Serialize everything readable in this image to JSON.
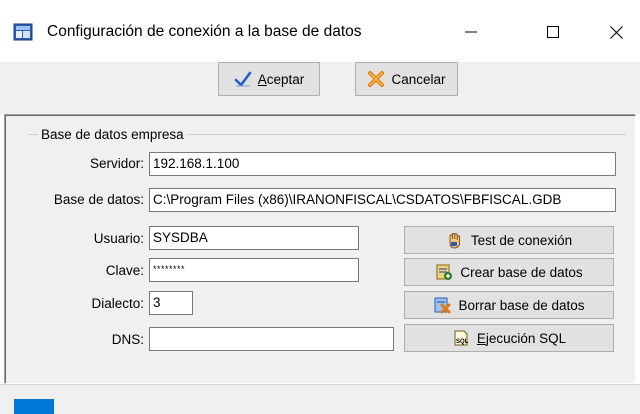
{
  "window": {
    "title": "Configuración de conexión a la base de datos"
  },
  "toolbar": {
    "accept_accel": "A",
    "accept_rest": "ceptar",
    "cancel_label": "Cancelar"
  },
  "group": {
    "title": "Base de datos empresa"
  },
  "fields": {
    "servidor_label": "Servidor:",
    "servidor_value": "192.168.1.100",
    "base_label": "Base de datos:",
    "base_value": "C:\\Program Files (x86)\\IRANONFISCAL\\CSDATOS\\FBFISCAL.GDB",
    "usuario_label": "Usuario:",
    "usuario_value": "SYSDBA",
    "clave_label": "Clave:",
    "clave_value": "********",
    "dialecto_label": "Dialecto:",
    "dialecto_value": "3",
    "dns_label": "DNS:",
    "dns_value": ""
  },
  "actions": {
    "test_label": "Test de conexión",
    "crear_label": "Crear base de datos",
    "borrar_label": "Borrar base de datos",
    "sql_accel": "E",
    "sql_rest": "jecución SQL"
  },
  "colors": {
    "accent": "#0078d7",
    "button_face": "#e1e1e1",
    "panel": "#f0f0f0"
  }
}
